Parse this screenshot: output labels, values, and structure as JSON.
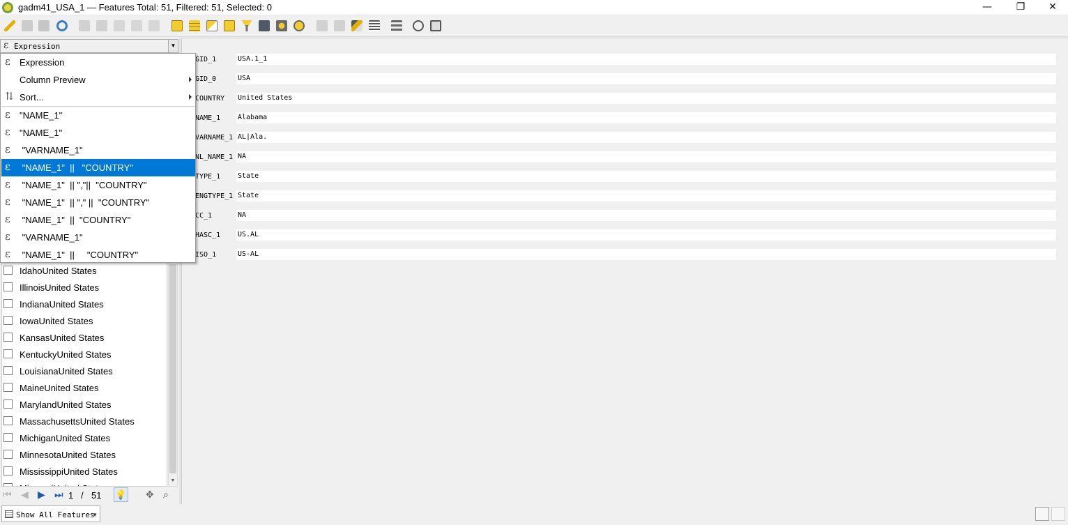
{
  "window": {
    "title": "gadm41_USA_1 — Features Total: 51, Filtered: 51, Selected: 0",
    "minimize": "—",
    "restore": "❐",
    "close": "✕"
  },
  "colors": {
    "selection": "#0078d7",
    "background": "#f0f0f0",
    "field_bg": "#ffffff"
  },
  "toolbar": {
    "icons": [
      "pencil-icon",
      "multi-edit-icon",
      "save-edits-icon",
      "reload-icon",
      "add-feature-icon",
      "delete-icon",
      "cut-icon",
      "copy-icon",
      "paste-icon",
      "select-expression-icon",
      "select-all-icon",
      "invert-selection-icon",
      "deselect-icon",
      "filter-icon",
      "move-selected-top-icon",
      "pan-to-selection-icon",
      "zoom-to-selection-icon",
      "new-field-icon",
      "delete-field-icon",
      "field-calculator-icon",
      "conditional-format-icon",
      "actions-icon",
      "zoom-icon",
      "dock-icon"
    ]
  },
  "expression_combo": {
    "icon": "ε",
    "value": "Expression"
  },
  "menu": {
    "items": [
      {
        "label": "Expression",
        "icon": "ε"
      },
      {
        "label": "Column Preview",
        "icon": ""
      },
      {
        "label": "Sort...",
        "icon": "⇅"
      },
      {
        "label": "\"NAME_1\"",
        "icon": "ε"
      },
      {
        "label": "\"NAME_1\"",
        "icon": "ε"
      },
      {
        "label": " \"VARNAME_1\"",
        "icon": "ε"
      },
      {
        "label": " \"NAME_1\"  ||   \"COUNTRY\"",
        "icon": "ε"
      },
      {
        "label": " \"NAME_1\"  || \",\"||  \"COUNTRY\"",
        "icon": "ε"
      },
      {
        "label": " \"NAME_1\"  || \",\" ||  \"COUNTRY\"",
        "icon": "ε"
      },
      {
        "label": " \"NAME_1\"  ||  \"COUNTRY\"",
        "icon": "ε"
      },
      {
        "label": " \"VARNAME_1\"",
        "icon": "ε"
      },
      {
        "label": " \"NAME_1\"  ||     \"COUNTRY\"",
        "icon": "ε"
      }
    ]
  },
  "features": [
    "IdahoUnited States",
    "IllinoisUnited States",
    "IndianaUnited States",
    "IowaUnited States",
    "KansasUnited States",
    "KentuckyUnited States",
    "LouisianaUnited States",
    "MaineUnited States",
    "MarylandUnited States",
    "MassachusettsUnited States",
    "MichiganUnited States",
    "MinnesotaUnited States",
    "MississippiUnited States",
    "MissouriUnited States"
  ],
  "navigation": {
    "current": "1",
    "separator": "/",
    "total": "51"
  },
  "bottom": {
    "show_features": "Show All Features"
  },
  "form": {
    "fields": [
      {
        "label": "GID_1",
        "value": "USA.1_1"
      },
      {
        "label": "GID_0",
        "value": "USA"
      },
      {
        "label": "COUNTRY",
        "value": "United States"
      },
      {
        "label": "NAME_1",
        "value": "Alabama"
      },
      {
        "label": "VARNAME_1",
        "value": "AL|Ala."
      },
      {
        "label": "NL_NAME_1",
        "value": "NA"
      },
      {
        "label": "TYPE_1",
        "value": "State"
      },
      {
        "label": "ENGTYPE_1",
        "value": "State"
      },
      {
        "label": "CC_1",
        "value": "NA"
      },
      {
        "label": "HASC_1",
        "value": "US.AL"
      },
      {
        "label": "ISO_1",
        "value": "US-AL"
      }
    ]
  }
}
